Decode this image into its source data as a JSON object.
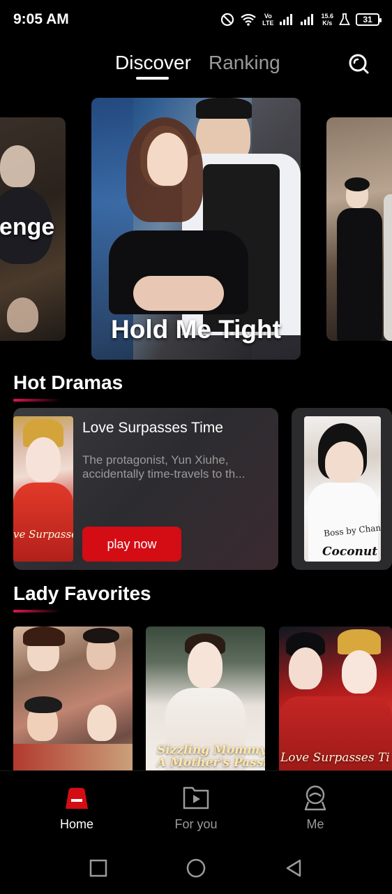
{
  "status_bar": {
    "time": "9:05 AM",
    "net_speed_value": "15.6",
    "net_speed_unit": "K/s",
    "volte_top": "Vo",
    "volte_bottom": "LTE",
    "battery": "31",
    "icons": [
      "dnd-icon",
      "wifi-icon",
      "signal-icon",
      "signal-icon-2",
      "lab-icon",
      "battery-icon"
    ]
  },
  "top_nav": {
    "tabs": [
      {
        "label": "Discover",
        "active": true
      },
      {
        "label": "Ranking",
        "active": false
      }
    ],
    "search_icon": "search-icon"
  },
  "carousel": {
    "left_title": "venge",
    "center_title": "Hold Me Tight"
  },
  "hot_dramas": {
    "title": "Hot Dramas",
    "cards": [
      {
        "title": "Love Surpasses Time",
        "description": "The protagonist, Yun Xiuhe, accidentally time-travels to th...",
        "poster_text": "ve Surpasses Time",
        "button_label": "play now"
      },
      {
        "poster_text_1": "Boss by Chance",
        "poster_text_2": "Coconut"
      }
    ]
  },
  "lady_favorites": {
    "title": "Lady Favorites",
    "posters": [
      {
        "text": ""
      },
      {
        "text_line1": "Sizzling Mommy:",
        "text_line2": "A Mother's Passion"
      },
      {
        "text": "Love Surpasses Ti"
      }
    ]
  },
  "bottom_nav": {
    "items": [
      {
        "label": "Home",
        "icon": "home-icon",
        "active": true
      },
      {
        "label": "For you",
        "icon": "play-folder-icon",
        "active": false
      },
      {
        "label": "Me",
        "icon": "profile-icon",
        "active": false
      }
    ],
    "accent_color": "#d40c14"
  },
  "system_nav": {
    "icons": [
      "recent-apps-icon",
      "home-circle-icon",
      "back-triangle-icon"
    ]
  }
}
